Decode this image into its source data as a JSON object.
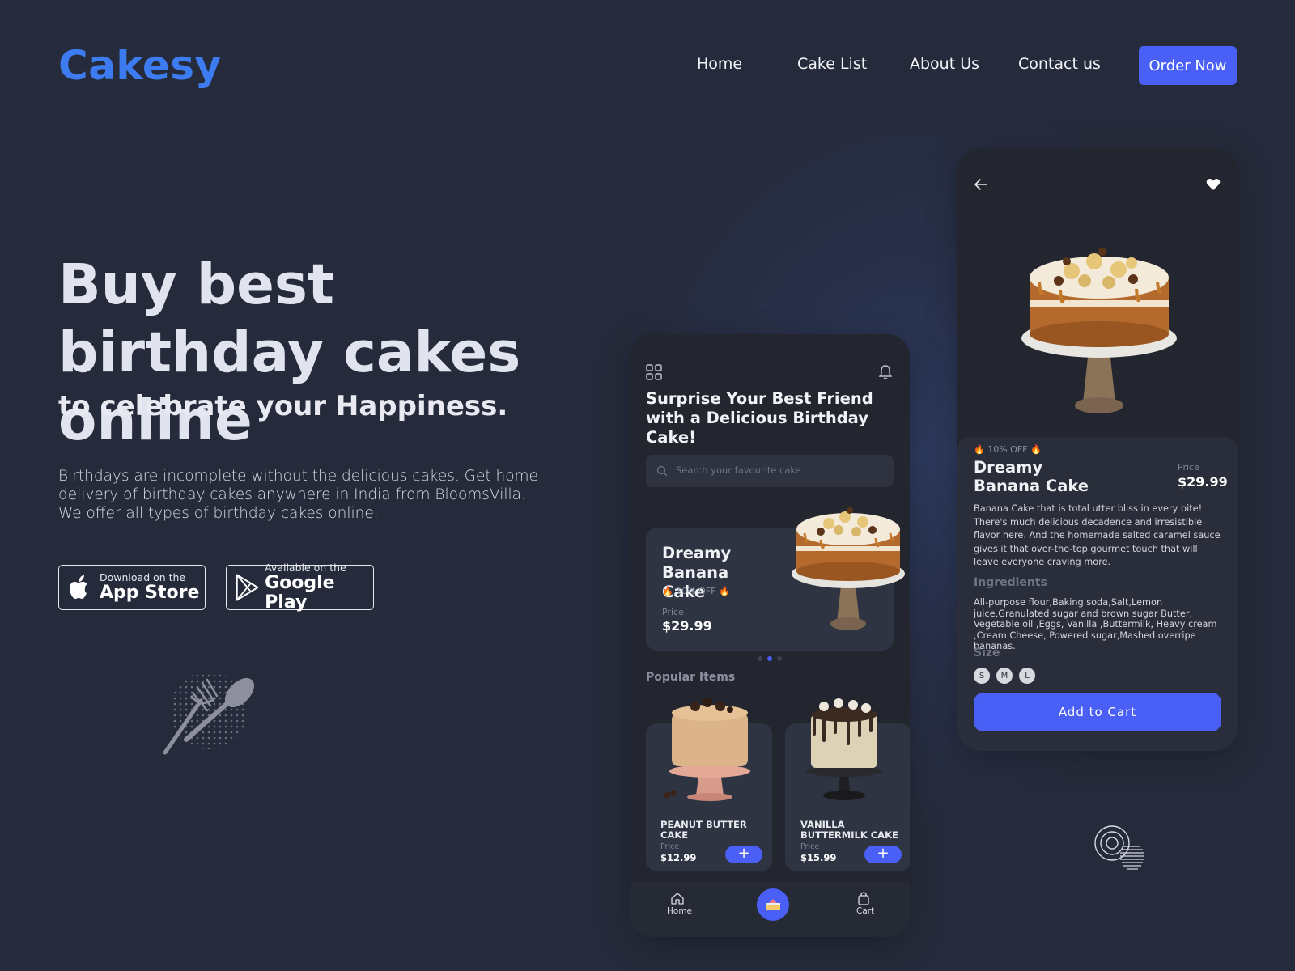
{
  "brand": {
    "name": "Cakesy",
    "accent": "#3d7bf0",
    "button": "#4a5ff5"
  },
  "nav": {
    "items": [
      "Home",
      "Cake List",
      "About Us",
      "Contact us"
    ],
    "cta": "Order Now"
  },
  "hero": {
    "title": "Buy best birthday cakes online",
    "subtitle": "to celebrate your Happiness.",
    "description": "Birthdays are incomplete without the delicious cakes. Get home delivery of birthday cakes anywhere in India from BloomsVilla. We offer all types of birthday cakes online."
  },
  "stores": {
    "apple": {
      "small": "Download on the",
      "big": "App Store",
      "icon": "apple-icon"
    },
    "google": {
      "small": "Available on the",
      "big": "Google Play",
      "icon": "google-play-icon"
    }
  },
  "phone_home": {
    "headline": "Surprise Your Best Friend with a Delicious Birthday Cake!",
    "search_placeholder": "Search your favourite cake",
    "featured": {
      "name": "Dreamy Banana Cake",
      "discount": "10% OFF",
      "price_label": "Price",
      "price": "$29.99"
    },
    "carousel_dots": 3,
    "carousel_active": 2,
    "popular_heading": "Popular Items",
    "items": [
      {
        "name": "PEANUT BUTTER CAKE",
        "price_label": "Price",
        "price": "$12.99",
        "add": "+"
      },
      {
        "name": "VANILLA BUTTERMILK CAKE",
        "price_label": "Price",
        "price": "$15.99",
        "add": "+"
      }
    ],
    "tabs": {
      "home": "Home",
      "cart": "Cart"
    }
  },
  "phone_detail": {
    "discount": "10% OFF",
    "name": "Dreamy Banana Cake",
    "price_label": "Price",
    "price": "$29.99",
    "description": "Banana Cake that is total utter bliss in every bite! There's much delicious decadence and irresistible flavor here. And the homemade salted caramel sauce gives it that over-the-top gourmet touch that will leave everyone craving more.",
    "ingredients_heading": "Ingredients",
    "ingredients": "All-purpose flour,Baking soda,Salt,Lemon juice,Granulated sugar and brown sugar Butter, Vegetable oil ,Eggs, Vanilla ,Buttermilk, Heavy cream ,Cream Cheese, Powered sugar,Mashed overripe bananas.",
    "size_heading": "Size",
    "sizes": [
      "S",
      "M",
      "L"
    ],
    "cta": "Add to Cart"
  }
}
